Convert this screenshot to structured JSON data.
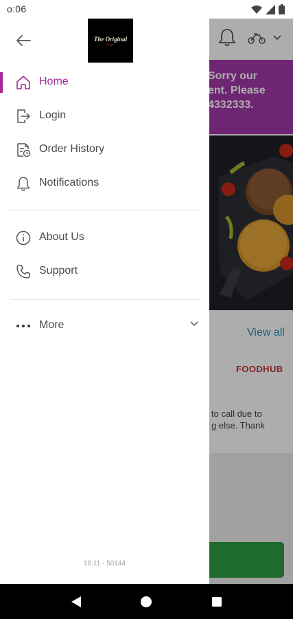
{
  "status_bar": {
    "time": "o:06"
  },
  "drawer": {
    "logo": {
      "title": "The Original",
      "subtitle": "Burger"
    },
    "items": [
      {
        "label": "Home",
        "icon": "home-icon",
        "active": true
      },
      {
        "label": "Login",
        "icon": "login-icon"
      },
      {
        "label": "Order History",
        "icon": "order-history-icon"
      },
      {
        "label": "Notifications",
        "icon": "bell-icon"
      },
      {
        "label": "About Us",
        "icon": "info-icon"
      },
      {
        "label": "Support",
        "icon": "phone-icon"
      },
      {
        "label": "More",
        "icon": "more-icon"
      }
    ],
    "version": "10.11 - 50144"
  },
  "background": {
    "banner_lines": [
      "Sorry our",
      "ent. Please",
      "4332333."
    ],
    "view_all": "View all",
    "brand": "FOODHUB",
    "message_lines": [
      "to call due to",
      "g else. Thank"
    ]
  },
  "colors": {
    "accent": "#a5279a",
    "banner": "#a237a9",
    "link": "#2a8fbf",
    "cta": "#2f9e44"
  }
}
